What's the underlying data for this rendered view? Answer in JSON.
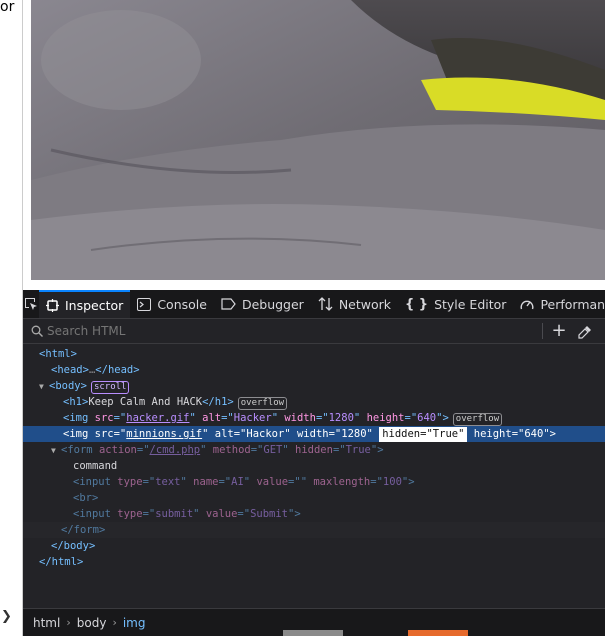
{
  "page_fragment": "or",
  "toolbar": {
    "tabs": [
      {
        "label": "Inspector",
        "icon": "inspector-icon"
      },
      {
        "label": "Console",
        "icon": "console-icon"
      },
      {
        "label": "Debugger",
        "icon": "debugger-icon"
      },
      {
        "label": "Network",
        "icon": "network-icon"
      },
      {
        "label": "Style Editor",
        "icon": "style-editor-icon"
      },
      {
        "label": "Performance",
        "icon": "performance-icon"
      }
    ]
  },
  "search": {
    "placeholder": "Search HTML"
  },
  "tree": {
    "html_open": "html",
    "head": "head",
    "body": "body",
    "badge_scroll": "scroll",
    "h1_text": "Keep Calm And HACK",
    "badge_overflow": "overflow",
    "img1": {
      "src": "hacker.gif",
      "alt": "Hacker",
      "width": "1280",
      "height": "640"
    },
    "img2": {
      "src": "minnions.gif",
      "alt": "Hackor",
      "width": "1280",
      "hidden": "True",
      "height": "640"
    },
    "form": {
      "action": "/cmd.php",
      "method": "GET",
      "hidden": "True"
    },
    "form_text": "command",
    "input1": {
      "type": "text",
      "name": "AI",
      "value": "",
      "maxlength": "100"
    },
    "br": "br",
    "input2": {
      "type": "submit",
      "value": "Submit"
    }
  },
  "breadcrumbs": [
    "html",
    "body",
    "img"
  ],
  "colors": {
    "accent": "#0a84ff",
    "selected_row": "#204e8a",
    "panel_bg": "#232327"
  }
}
